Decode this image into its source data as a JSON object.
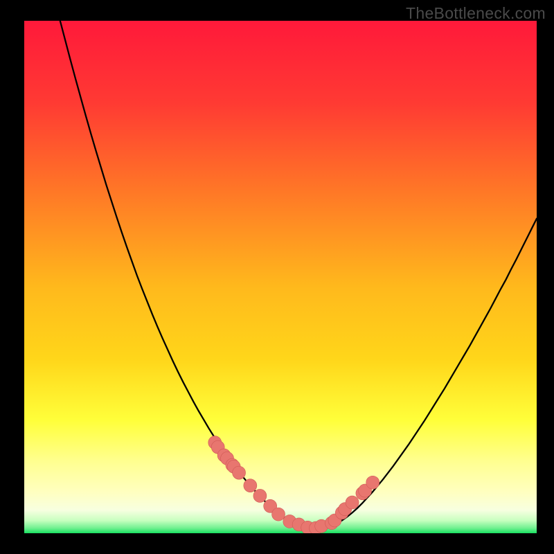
{
  "watermark_text": "TheBottleneck.com",
  "colors": {
    "background": "#000000",
    "gradient_top": "#ff193a",
    "gradient_mid_upper": "#ff6a2d",
    "gradient_mid": "#ffd61a",
    "gradient_mid_lower": "#ffff44",
    "gradient_lower": "#ffffc0",
    "gradient_bottom": "#18e060",
    "curve": "#000000",
    "marker_fill": "#e8766f",
    "marker_stroke": "#cf5a55"
  },
  "chart_data": {
    "type": "line",
    "title": "",
    "xlabel": "",
    "ylabel": "",
    "xlim": [
      0,
      100
    ],
    "ylim": [
      0,
      100
    ],
    "grid": false,
    "legend": false,
    "curve": {
      "x": [
        7,
        8,
        9,
        10,
        11,
        12,
        13,
        14,
        15,
        16,
        17,
        18,
        19,
        20,
        21,
        22,
        23,
        24,
        25,
        26,
        27,
        28,
        29,
        30,
        31,
        32,
        33,
        34,
        35,
        36,
        37,
        38,
        39,
        40,
        41,
        42,
        43,
        44,
        45,
        46,
        47,
        48,
        49,
        50,
        51,
        52,
        53,
        54,
        55,
        56,
        57,
        58,
        59,
        60,
        61,
        62,
        63,
        64,
        65,
        66,
        67,
        68,
        69,
        70,
        71,
        72,
        73,
        74,
        75,
        76,
        77,
        78,
        79,
        80,
        81,
        82,
        83,
        84,
        85,
        86,
        87,
        88,
        89,
        90,
        91,
        92,
        93,
        94,
        95,
        96,
        97,
        98,
        99,
        100
      ],
      "y": [
        100,
        96.2,
        92.4,
        88.7,
        85.1,
        81.5,
        78.0,
        74.6,
        71.3,
        68.0,
        64.9,
        61.8,
        58.8,
        55.9,
        53.1,
        50.3,
        47.7,
        45.2,
        42.7,
        40.3,
        38.0,
        35.8,
        33.6,
        31.5,
        29.5,
        27.6,
        25.7,
        23.9,
        22.2,
        20.5,
        18.9,
        17.4,
        15.9,
        14.5,
        13.1,
        11.8,
        10.6,
        9.4,
        8.3,
        7.2,
        6.2,
        5.3,
        4.4,
        3.6,
        2.9,
        2.3,
        1.8,
        1.4,
        1.1,
        1.0,
        1.0,
        1.0,
        1.1,
        1.4,
        1.9,
        2.5,
        3.2,
        4.0,
        4.9,
        5.9,
        7.0,
        8.1,
        9.3,
        10.5,
        11.8,
        13.1,
        14.5,
        15.9,
        17.3,
        18.8,
        20.3,
        21.8,
        23.4,
        25.0,
        26.6,
        28.2,
        29.9,
        31.6,
        33.3,
        35.0,
        36.7,
        38.5,
        40.3,
        42.1,
        43.9,
        45.8,
        47.7,
        49.5,
        51.5,
        53.4,
        55.4,
        57.4,
        59.4,
        61.4
      ]
    },
    "markers": {
      "x": [
        37.2,
        37.8,
        39.0,
        39.6,
        40.6,
        40.9,
        41.9,
        44.1,
        46.0,
        48.0,
        49.6,
        51.8,
        53.6,
        55.3,
        56.9,
        58.0,
        60.0,
        60.6,
        62.0,
        62.6,
        64.0,
        66.0,
        66.5,
        68.0
      ],
      "y": [
        17.7,
        16.8,
        15.2,
        14.6,
        13.3,
        13.0,
        11.8,
        9.3,
        7.3,
        5.3,
        3.7,
        2.3,
        1.7,
        1.1,
        1.0,
        1.4,
        2.0,
        2.5,
        4.0,
        4.7,
        6.0,
        7.8,
        8.3,
        9.9
      ]
    }
  }
}
